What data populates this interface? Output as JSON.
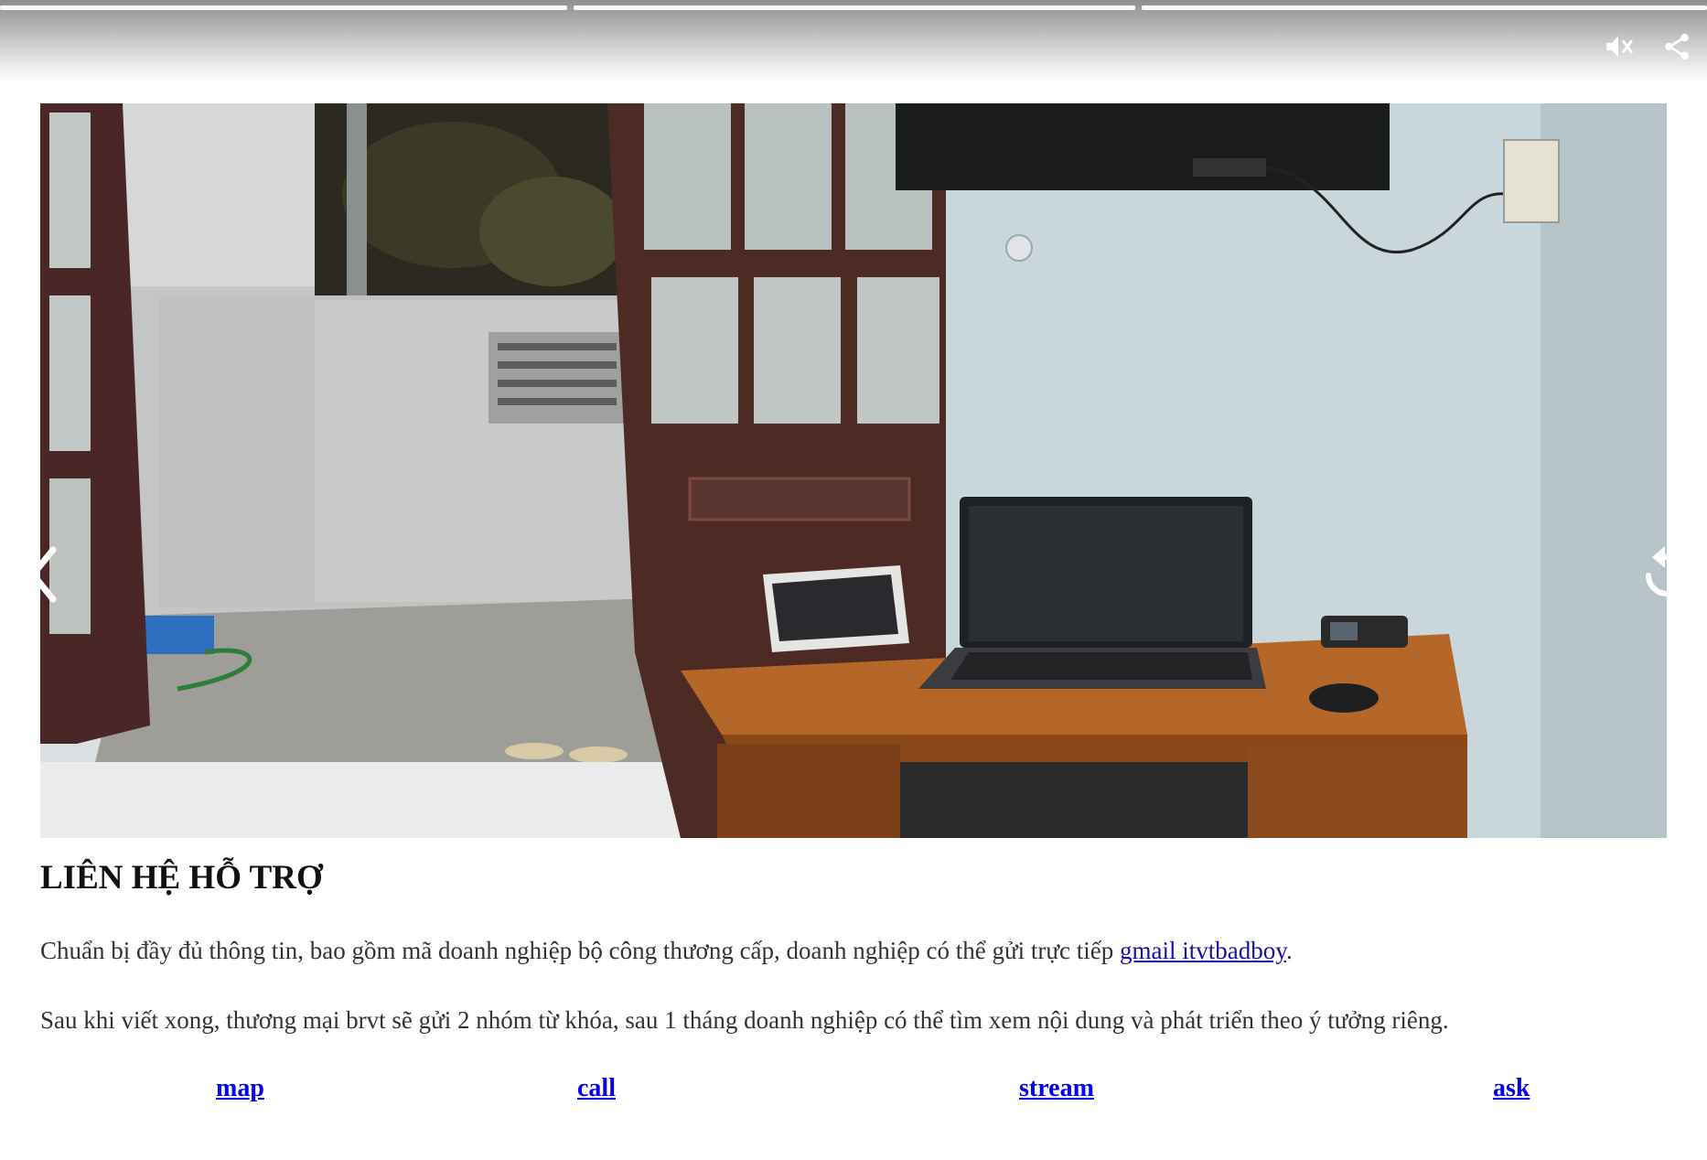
{
  "story": {
    "progress_segments": 3,
    "icons": {
      "mute": "mute-icon",
      "share": "share-icon"
    }
  },
  "hero": {
    "nav_prev": "chevron-left-icon",
    "nav_next": "replay-icon"
  },
  "content": {
    "heading": "LIÊN HỆ HỖ TRỢ",
    "para1_text": "Chuẩn bị đầy đủ thông tin, bao gồm mã doanh nghiệp bộ công thương cấp, doanh nghiệp có thể gửi trực tiếp ",
    "para1_link": "gmail itvtbadboy",
    "para1_end": ".",
    "para2_text": "Sau khi viết xong, thương mại brvt sẽ gửi 2 nhóm từ khóa, sau 1 tháng doanh nghiệp có thể tìm xem nội dung và phát triển theo ý tưởng riêng."
  },
  "links": {
    "map": "map",
    "call": "call",
    "stream": "stream",
    "ask": "ask"
  },
  "colors": {
    "link": "#0000ee",
    "body_text": "#333333",
    "heading": "#111111"
  }
}
